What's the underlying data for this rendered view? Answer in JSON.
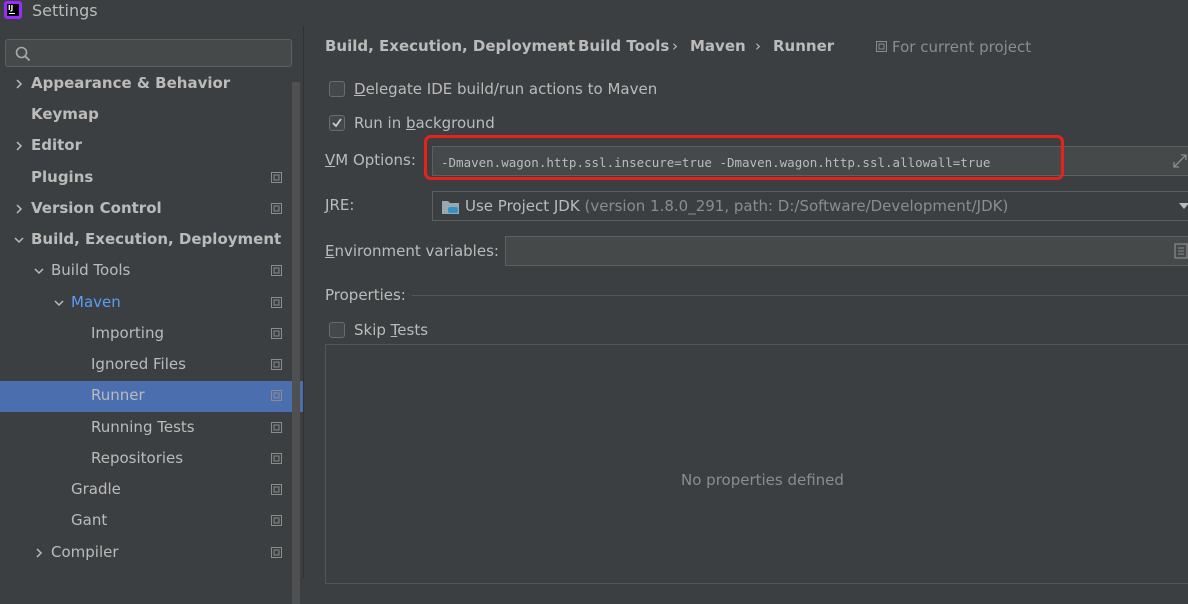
{
  "window": {
    "title": "Settings",
    "app_icon_letters": "IJ"
  },
  "search": {
    "placeholder": "",
    "value": ""
  },
  "sidebar": {
    "items": [
      {
        "label": "Appearance & Behavior",
        "bold": true,
        "arrow": "right",
        "project": false
      },
      {
        "label": "Keymap",
        "bold": true,
        "arrow": "",
        "project": false
      },
      {
        "label": "Editor",
        "bold": true,
        "arrow": "right",
        "project": false
      },
      {
        "label": "Plugins",
        "bold": true,
        "arrow": "",
        "project": true
      },
      {
        "label": "Version Control",
        "bold": true,
        "arrow": "right",
        "project": true
      },
      {
        "label": "Build, Execution, Deployment",
        "bold": true,
        "arrow": "down",
        "project": false
      },
      {
        "label": "Build Tools",
        "bold": false,
        "arrow": "down",
        "project": true
      },
      {
        "label": "Maven",
        "bold": false,
        "arrow": "down",
        "project": true,
        "active": true
      },
      {
        "label": "Importing",
        "bold": false,
        "arrow": "",
        "project": true
      },
      {
        "label": "Ignored Files",
        "bold": false,
        "arrow": "",
        "project": true
      },
      {
        "label": "Runner",
        "bold": false,
        "arrow": "",
        "project": true,
        "selected": true
      },
      {
        "label": "Running Tests",
        "bold": false,
        "arrow": "",
        "project": true
      },
      {
        "label": "Repositories",
        "bold": false,
        "arrow": "",
        "project": true
      },
      {
        "label": "Gradle",
        "bold": false,
        "arrow": "",
        "project": true
      },
      {
        "label": "Gant",
        "bold": false,
        "arrow": "",
        "project": true
      },
      {
        "label": "Compiler",
        "bold": false,
        "arrow": "right",
        "project": true
      }
    ]
  },
  "breadcrumb": {
    "items": [
      "Build, Execution, Deployment",
      "Build Tools",
      "Maven",
      "Runner"
    ],
    "separator": "›",
    "scope": "For current project"
  },
  "options": {
    "delegate": {
      "pre": "",
      "mnemonic": "D",
      "post": "elegate IDE build/run actions to Maven",
      "checked": false
    },
    "background": {
      "pre": "Run in ",
      "mnemonic": "b",
      "post": "ackground",
      "checked": true
    },
    "vm": {
      "label_mnemonic": "V",
      "label_rest": "M Options:",
      "value": "-Dmaven.wagon.http.ssl.insecure=true -Dmaven.wagon.http.ssl.allowall=true"
    },
    "jre": {
      "label_mnemonic": "J",
      "label_rest": "RE:",
      "value": "Use Project JDK",
      "detail": "(version 1.8.0_291, path: D:/Software/Development/JDK)"
    },
    "env": {
      "label_mnemonic": "E",
      "label_rest": "nvironment variables:",
      "value": ""
    },
    "properties_label": "Properties:",
    "skip_tests": {
      "pre": "Skip ",
      "mnemonic": "T",
      "post": "ests",
      "checked": false
    },
    "no_properties": "No properties defined"
  },
  "colors": {
    "background": "#3c3f41",
    "selection": "#4b6eaf",
    "active_link": "#589df6",
    "highlight_box": "#e8221b"
  }
}
